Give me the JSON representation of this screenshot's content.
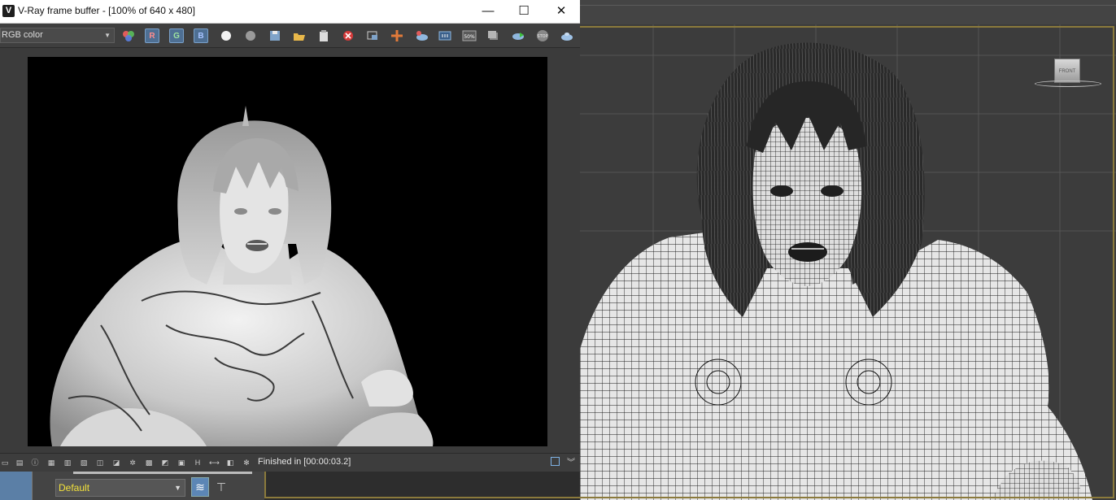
{
  "vfb": {
    "title": "V-Ray frame buffer - [100% of 640 x 480]",
    "app_icon": "vray-logo-icon",
    "window_buttons": {
      "minimize": "—",
      "maximize": "☐",
      "close": "✕"
    },
    "toolbar": {
      "channel": "RGB color",
      "red_label": "R",
      "green_label": "G",
      "blue_label": "B",
      "icons": [
        "color-mode-icon",
        "red-channel-icon",
        "green-channel-icon",
        "blue-channel-icon",
        "alpha-channel-icon",
        "monochrome-icon",
        "save-icon",
        "load-icon",
        "duplicate-icon",
        "clear-icon",
        "track-mouse-icon",
        "follow-mouse-icon",
        "region-render-icon",
        "lens-effects-icon",
        "zoom-50-icon",
        "link-icon",
        "render-interactive-icon",
        "stop-icon",
        "render-icon"
      ],
      "zoom_label": "50%",
      "stop_label": "STOP"
    },
    "status": {
      "text": "Finished in [00:00:03.2]"
    }
  },
  "max": {
    "layer": "Default",
    "viewcube_label": "FRONT"
  }
}
